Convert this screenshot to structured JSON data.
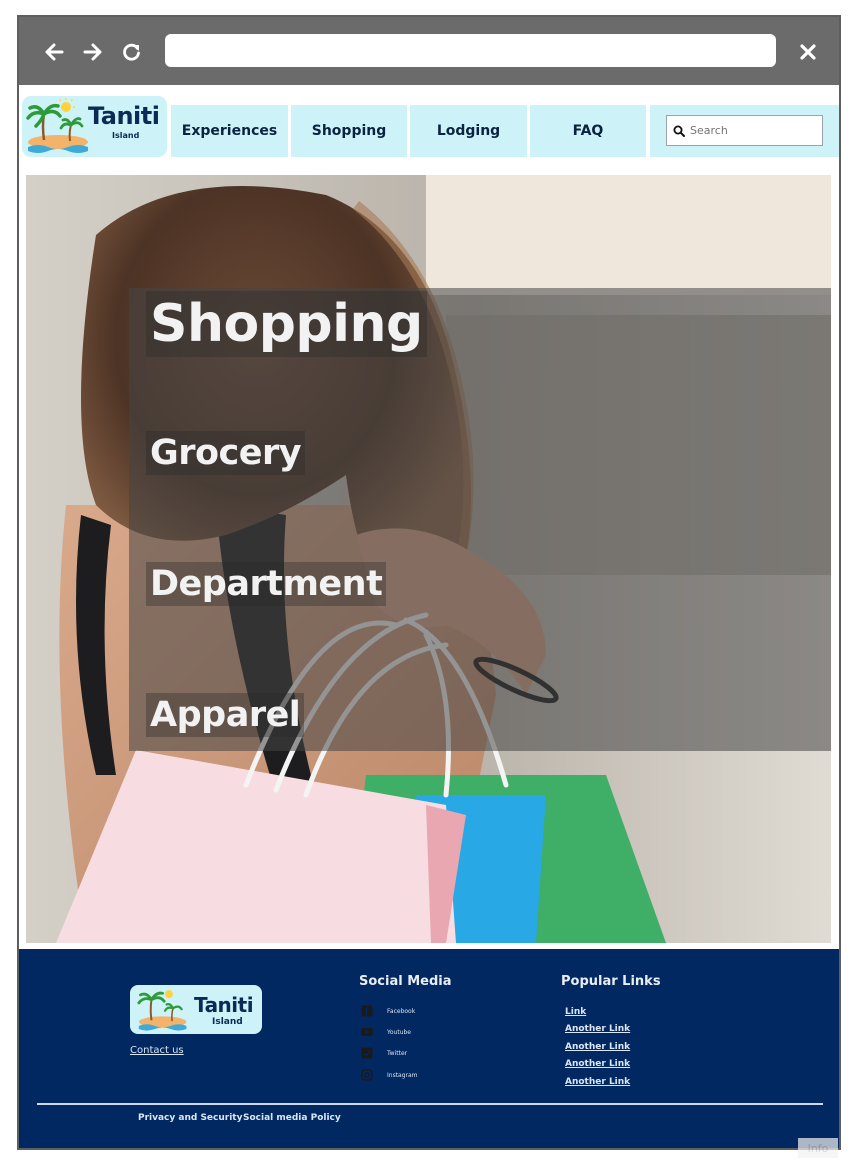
{
  "browser": {
    "back_icon": "arrow-left-icon",
    "forward_icon": "arrow-right-icon",
    "reload_icon": "reload-icon",
    "address_value": "",
    "close_icon": "close-icon"
  },
  "header": {
    "logo": {
      "name": "Taniti",
      "sub": "Island"
    },
    "nav": [
      "Experiences",
      "Shopping",
      "Lodging",
      "FAQ"
    ],
    "search": {
      "placeholder": "Search",
      "icon": "search-icon"
    }
  },
  "hero": {
    "title": "Shopping",
    "links": [
      "Grocery",
      "Department",
      "Apparel"
    ]
  },
  "footer": {
    "logo": {
      "name": "Taniti",
      "sub": "Island"
    },
    "contact": "Contact us",
    "social_heading": "Social Media",
    "social": [
      {
        "label": "Facebook",
        "icon": "facebook-icon"
      },
      {
        "label": "Youtube",
        "icon": "youtube-icon"
      },
      {
        "label": "Twitter",
        "icon": "twitter-icon"
      },
      {
        "label": "Instagram",
        "icon": "instagram-icon"
      }
    ],
    "popular_heading": "Popular Links",
    "popular": [
      "Link",
      "Another Link",
      "Another Link",
      "Another Link",
      "Another Link"
    ],
    "legal": [
      "Privacy and Security",
      "Social media Policy"
    ]
  },
  "colors": {
    "chrome": "#6b6b6b",
    "nav_bg": "#cdf3f8",
    "nav_text": "#0b2340",
    "footer_bg": "#022861"
  },
  "info_tag": "Info"
}
